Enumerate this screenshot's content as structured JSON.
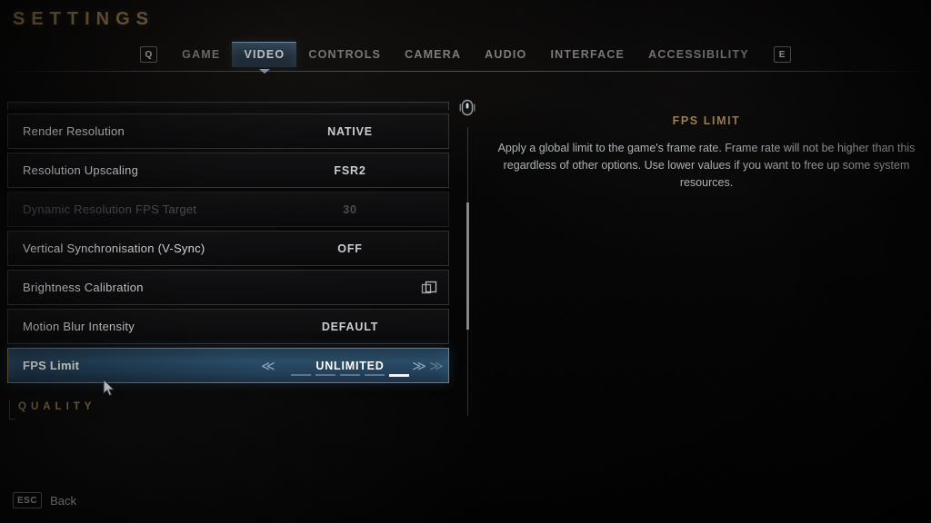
{
  "header": {
    "title": "SETTINGS",
    "tab_prev_key": "Q",
    "tab_next_key": "E",
    "tabs": [
      {
        "label": "GAME",
        "active": false
      },
      {
        "label": "VIDEO",
        "active": true
      },
      {
        "label": "CONTROLS",
        "active": false
      },
      {
        "label": "CAMERA",
        "active": false
      },
      {
        "label": "AUDIO",
        "active": false
      },
      {
        "label": "INTERFACE",
        "active": false
      },
      {
        "label": "ACCESSIBILITY",
        "active": false
      }
    ]
  },
  "settings_list": {
    "rows": [
      {
        "label": "Render Resolution",
        "value": "NATIVE",
        "state": "normal",
        "icon": ""
      },
      {
        "label": "Resolution Upscaling",
        "value": "FSR2",
        "state": "normal",
        "icon": ""
      },
      {
        "label": "Dynamic Resolution FPS Target",
        "value": "30",
        "state": "disabled",
        "icon": ""
      },
      {
        "label": "Vertical Synchronisation (V-Sync)",
        "value": "OFF",
        "state": "normal",
        "icon": ""
      },
      {
        "label": "Brightness Calibration",
        "value": "",
        "state": "normal",
        "icon": "submenu-icon"
      },
      {
        "label": "Motion Blur Intensity",
        "value": "DEFAULT",
        "state": "normal",
        "icon": ""
      },
      {
        "label": "FPS Limit",
        "value": "UNLIMITED",
        "state": "selected",
        "icon": ""
      }
    ],
    "selected_index": 6,
    "selected_segments": 5,
    "selected_segment_active": 5,
    "arrow_left": "≪",
    "arrow_right": "≫",
    "section_header": "QUALITY"
  },
  "description": {
    "title": "FPS LIMIT",
    "body": "Apply a global limit to the game's frame rate. Frame rate will not be higher than this regardless of other options. Use lower values if you want to free up some system resources."
  },
  "footer": {
    "back_key": "ESC",
    "back_label": "Back"
  },
  "colors": {
    "accent_bronze": "#a78a5c",
    "highlight_blue": "#2b4c66",
    "selected_border": "#8a7452",
    "text_primary": "#d2d6d9",
    "text_disabled": "#4a4d50",
    "tab_active_text": "#eef3f7"
  }
}
